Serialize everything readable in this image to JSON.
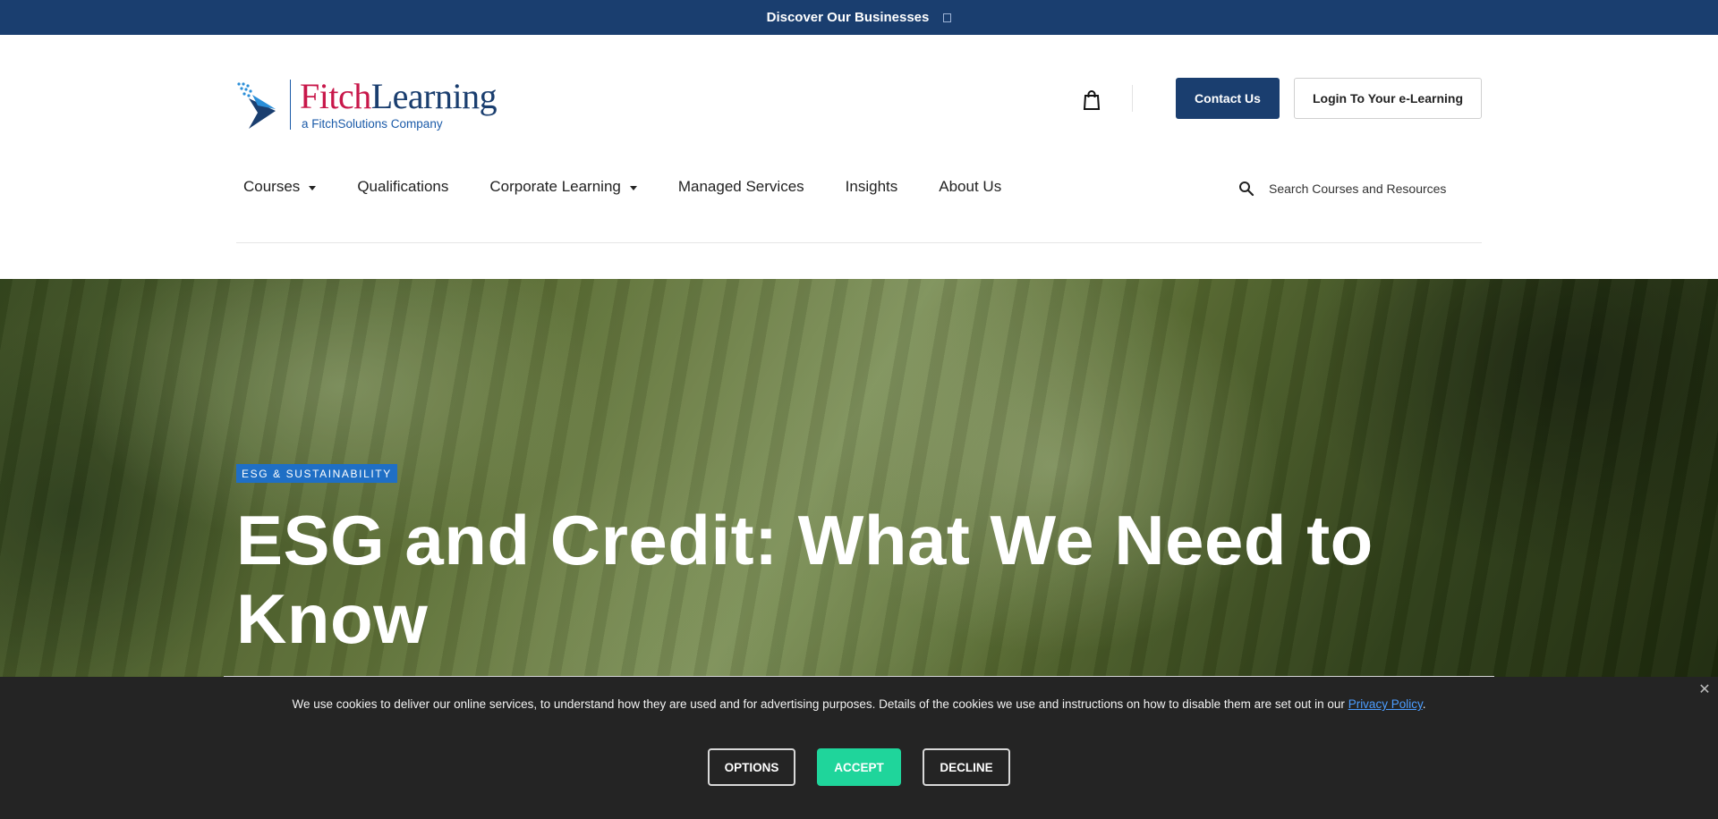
{
  "topbar": {
    "label": "Discover Our Businesses",
    "icon": "square-icon"
  },
  "logo": {
    "word_fitch": "Fitch",
    "word_learning": "Learning",
    "tagline": "a FitchSolutions Company",
    "colors": {
      "fitch": "#c8174a",
      "learning": "#1a3e6f"
    }
  },
  "header": {
    "cart_icon": "shopping-bag-icon",
    "contact_label": "Contact Us",
    "login_label": "Login To Your e-Learning"
  },
  "nav": {
    "items": [
      {
        "label": "Courses",
        "dropdown": true
      },
      {
        "label": "Qualifications",
        "dropdown": false
      },
      {
        "label": "Corporate Learning",
        "dropdown": true
      },
      {
        "label": "Managed Services",
        "dropdown": false
      },
      {
        "label": "Insights",
        "dropdown": false
      },
      {
        "label": "About Us",
        "dropdown": false
      }
    ]
  },
  "search": {
    "placeholder": "Search Courses and Resources",
    "icon": "search-icon"
  },
  "hero": {
    "tag": "ESG & SUSTAINABILITY",
    "title": "ESG and Credit: What We Need to Know"
  },
  "cookie": {
    "text": "We use cookies to deliver our online services, to understand how they are used and for advertising purposes. Details of the cookies we use and instructions on how to disable them are set out in our",
    "link_label": "Privacy Policy",
    "trailing": ".",
    "options_label": "OPTIONS",
    "accept_label": "ACCEPT",
    "decline_label": "DECLINE",
    "close_icon": "close-icon"
  },
  "colors": {
    "brand_navy": "#1a3e6f",
    "tag_blue": "#1f6fc5",
    "accept_green": "#1fd59b",
    "banner_bg": "#242424"
  }
}
